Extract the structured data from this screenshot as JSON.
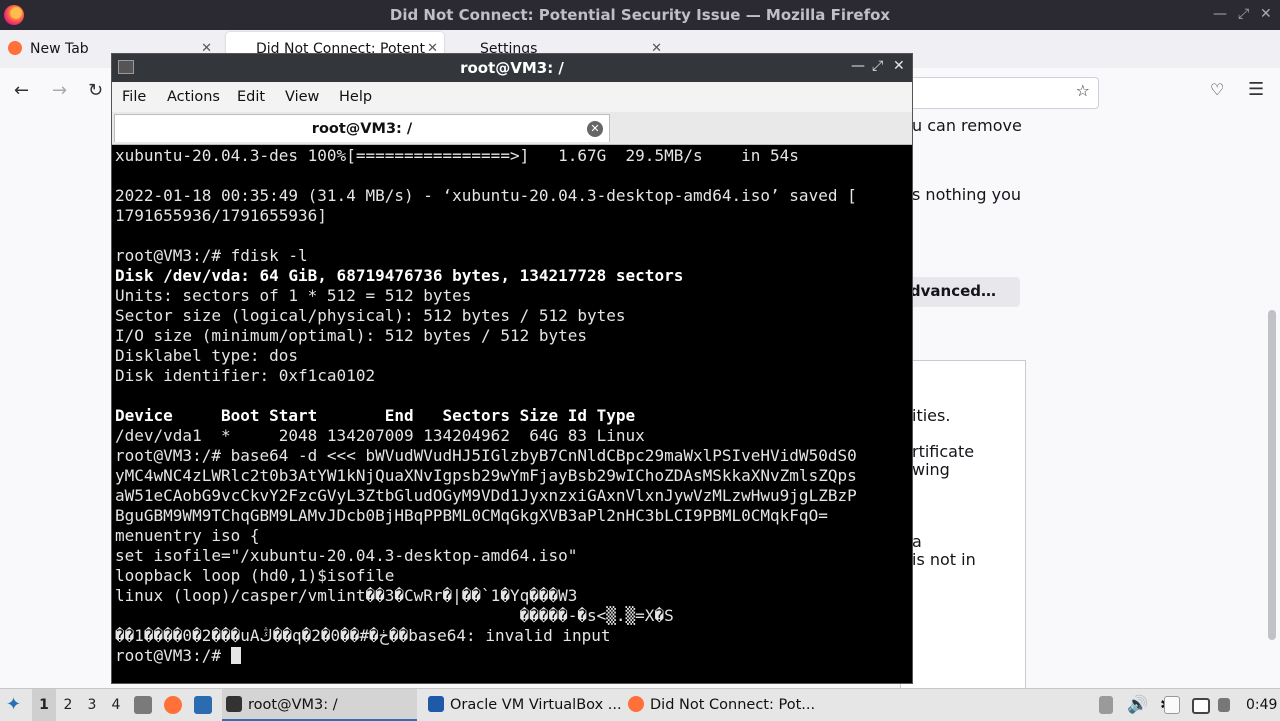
{
  "firefox": {
    "window_title": "Did Not Connect: Potential Security Issue — Mozilla Firefox",
    "tabs": [
      {
        "label": "New Tab"
      },
      {
        "label": "Did Not Connect: Potent"
      },
      {
        "label": "Settings"
      }
    ],
    "page_fragments": [
      "u can remove",
      "s nothing you",
      "dvanced…",
      "ities.",
      "rtificate",
      "wing",
      "a",
      "is not in"
    ]
  },
  "terminal": {
    "window_title": "root@VM3: /",
    "menu": [
      "File",
      "Actions",
      "Edit",
      "View",
      "Help"
    ],
    "tab_label": "root@VM3: /",
    "lines": [
      {
        "t": "xubuntu-20.04.3-des 100%[================>]   1.67G  29.5MB/s    in 54s"
      },
      {
        "t": ""
      },
      {
        "t": "2022-01-18 00:35:49 (31.4 MB/s) - ‘xubuntu-20.04.3-desktop-amd64.iso’ saved ["
      },
      {
        "t": "1791655936/1791655936]"
      },
      {
        "t": ""
      },
      {
        "t": "root@VM3:/# fdisk -l"
      },
      {
        "t": "Disk /dev/vda: 64 GiB, 68719476736 bytes, 134217728 sectors",
        "bold": true
      },
      {
        "t": "Units: sectors of 1 * 512 = 512 bytes"
      },
      {
        "t": "Sector size (logical/physical): 512 bytes / 512 bytes"
      },
      {
        "t": "I/O size (minimum/optimal): 512 bytes / 512 bytes"
      },
      {
        "t": "Disklabel type: dos"
      },
      {
        "t": "Disk identifier: 0xf1ca0102"
      },
      {
        "t": ""
      },
      {
        "t": "Device     Boot Start       End   Sectors Size Id Type",
        "bold": true
      },
      {
        "t": "/dev/vda1  *     2048 134207009 134204962  64G 83 Linux"
      },
      {
        "t": "root@VM3:/# base64 -d <<< bWVudWVudHJ5IGlzbyB7CnNldCBpc29maWxlPSIveHVidW50dS0"
      },
      {
        "t": "yMC4wNC4zLWRlc2t0b3AtYW1kNjQuaXNvIgpsb29wYmFjayBsb29wIChoZDAsMSkkaXNvZmlsZQps"
      },
      {
        "t": "aW51eCAobG9vcCkvY2FzcGVyL3ZtbGludOGyM9VDd1JyxnzxiGAxnVlxnJywVzMLzwHwu9jgLZBzP"
      },
      {
        "t": "BguGBM9WM9TChqGBM9LAMvJDcb0BjHBqPPBML0CMqGkgXVB3aPl2nHC3bLCI9PBML0CMqkFqO="
      },
      {
        "t": "menuentry iso {"
      },
      {
        "t": "set isofile=\"/xubuntu-20.04.3-desktop-amd64.iso\""
      },
      {
        "t": "loopback loop (hd0,1)$isofile"
      },
      {
        "t": "linux (loop)/casper/vmlint��3�CwRr�|��`1�Yq���W3"
      },
      {
        "t": "                                          �����-�s<▒.▒=X�S"
      },
      {
        "t": "��1����0�2���uAڭ��q�2�0��#�ڂ��base64: invalid input"
      },
      {
        "t": "root@VM3:/# "
      }
    ]
  },
  "taskbar": {
    "workspaces": [
      "1",
      "2",
      "3",
      "4"
    ],
    "tasks": [
      {
        "label": "root@VM3: /"
      },
      {
        "label": "Oracle VM VirtualBox ..."
      },
      {
        "label": "Did Not Connect: Pot..."
      }
    ],
    "clock": "0:49"
  }
}
